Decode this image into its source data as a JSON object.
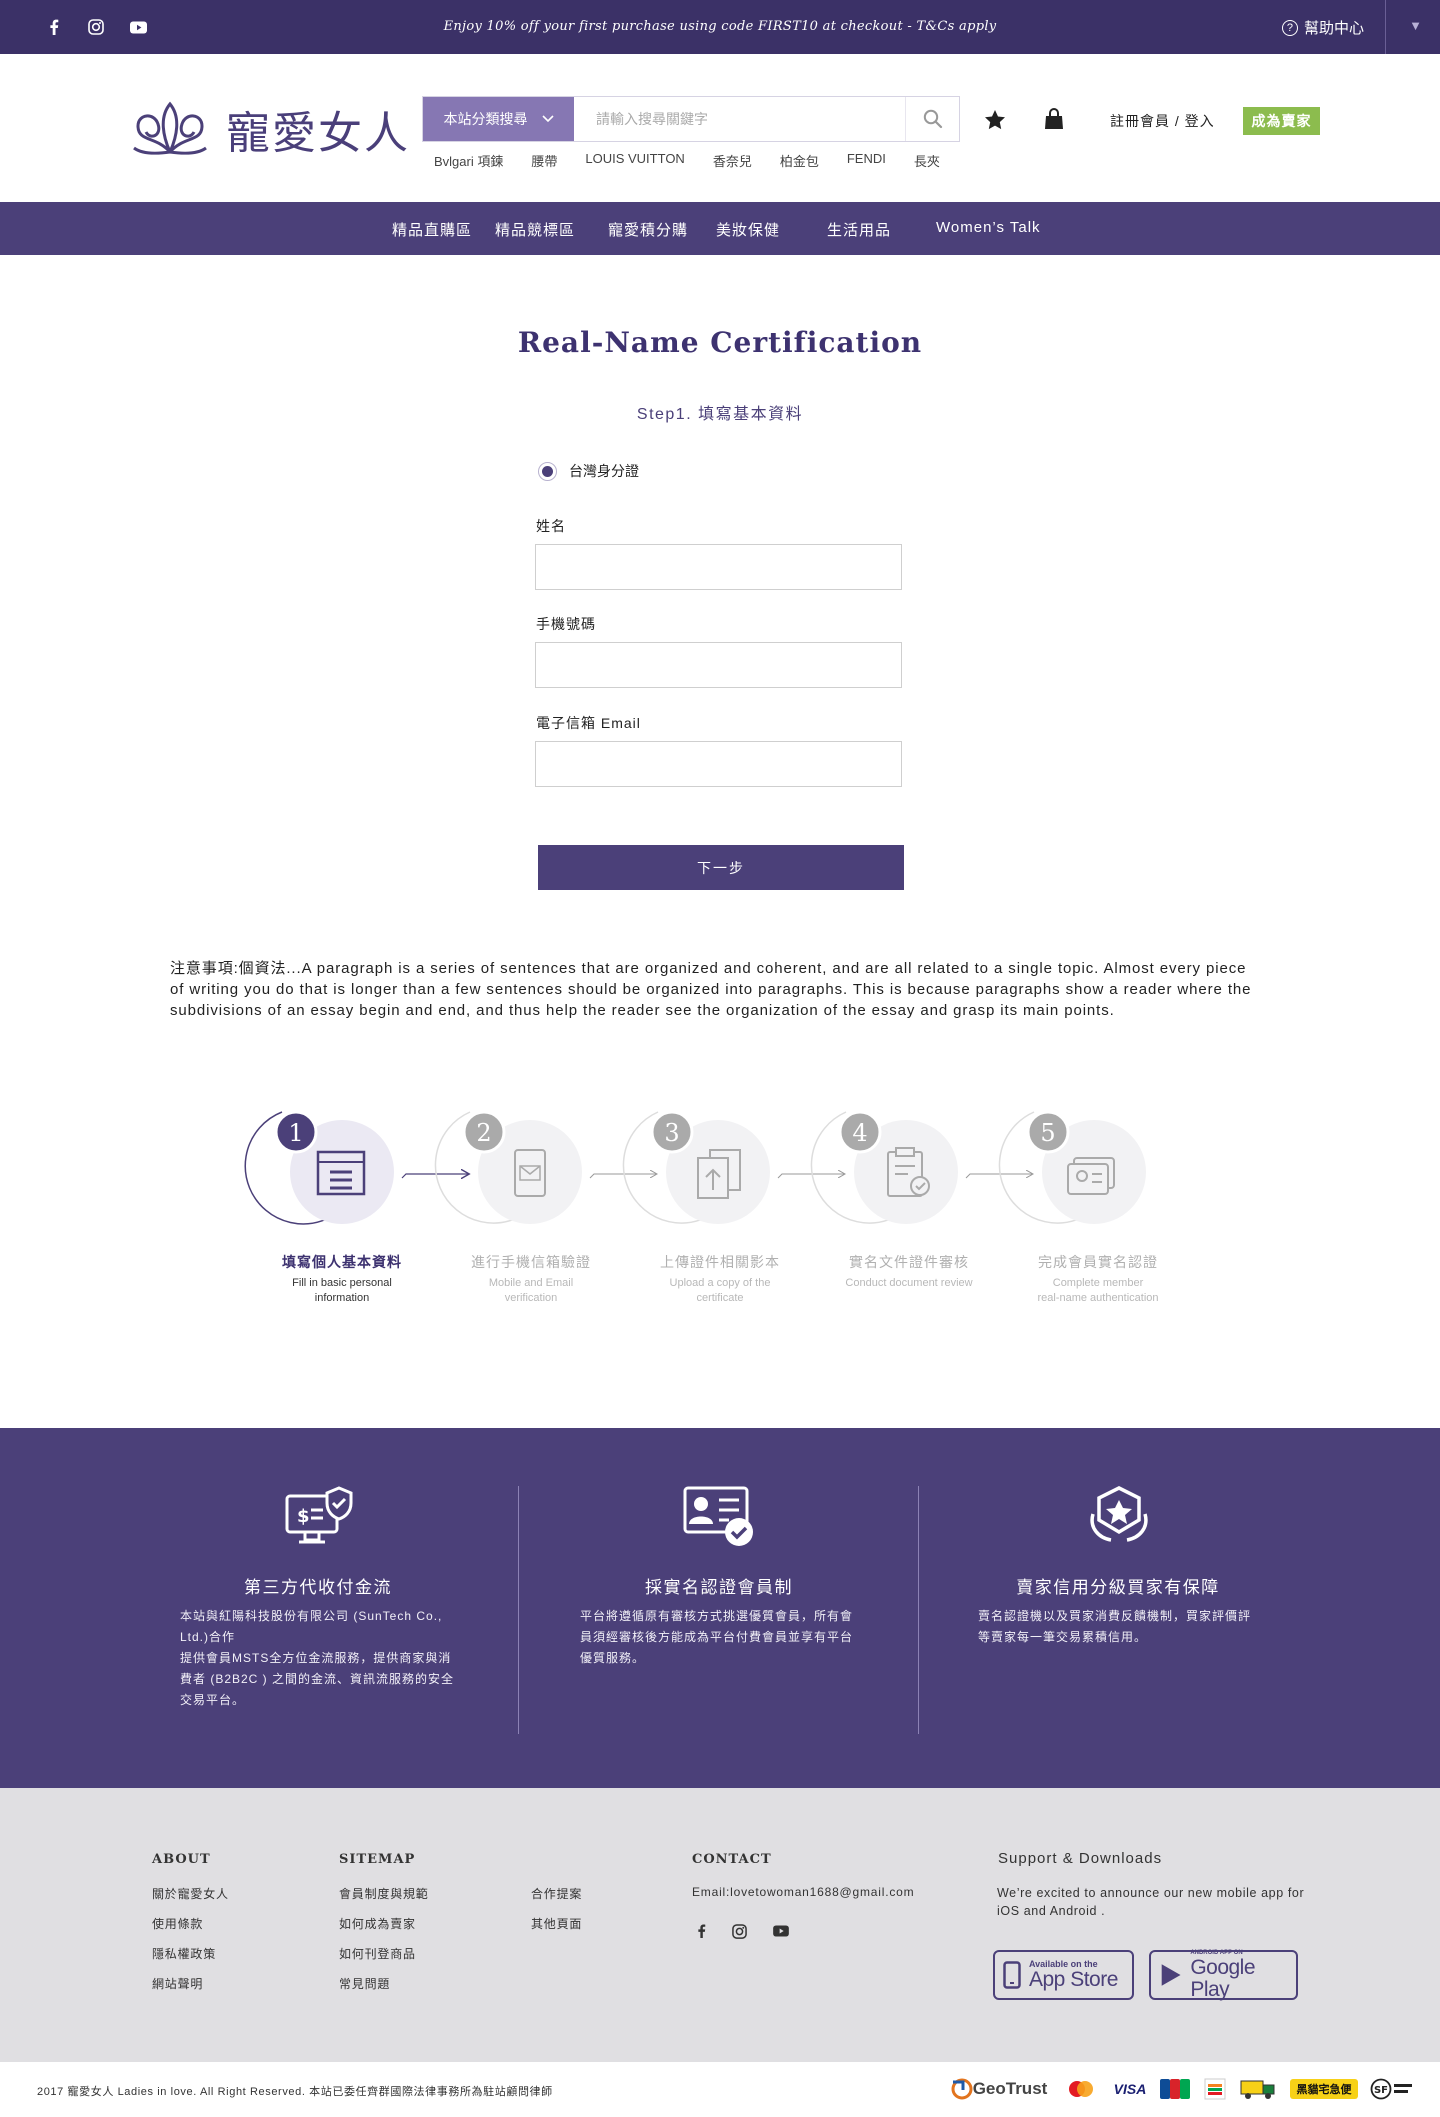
{
  "topbar": {
    "promo": "Enjoy 10% off your first purchase using code FIRST10 at checkout - T&Cs apply",
    "help": "幫助中心",
    "social_icons": [
      "facebook-icon",
      "instagram-icon",
      "youtube-icon"
    ]
  },
  "header": {
    "logo_text": "寵愛女人",
    "search": {
      "category": "本站分類搜尋",
      "placeholder": "請輸入搜尋關鍵字"
    },
    "hot_keywords": [
      "Bvlgari 項鍊",
      "腰帶",
      "LOUIS VUITTON",
      "香奈兒",
      "柏金包",
      "FENDI",
      "長夾"
    ],
    "login": "註冊會員 / 登入",
    "seller_button": "成為賣家"
  },
  "nav": {
    "items": [
      "精品直購區",
      "精品競標區",
      "寵愛積分購",
      "美妝保健",
      "生活用品",
      "Women’s Talk"
    ]
  },
  "form": {
    "title": "Real-Name Certification",
    "step": "Step1. 填寫基本資料",
    "id_type": "台灣身分證",
    "name_label": "姓名",
    "phone_label": "手機號碼",
    "email_label": "電子信箱 Email",
    "name_value": "",
    "phone_value": "",
    "email_value": "",
    "next_button": "下一步"
  },
  "note": "注意事項:個資法...A paragraph is a series of sentences that are organized and coherent, and are all related to a single topic. Almost every piece of writing you do that is longer than a few sentences should be organized into paragraphs. This is because paragraphs show a reader where the subdivisions of an essay begin and end, and thus help the reader see the organization of the essay and grasp its main points.",
  "steps": [
    {
      "num": "1",
      "title": "填寫個人基本資料",
      "sub1": "Fill in basic personal",
      "sub2": "information",
      "active": true
    },
    {
      "num": "2",
      "title": "進行手機信箱驗證",
      "sub1": "Mobile and Email",
      "sub2": "verification",
      "active": false
    },
    {
      "num": "3",
      "title": "上傳證件相關影本",
      "sub1": "Upload a copy of the",
      "sub2": "certificate",
      "active": false
    },
    {
      "num": "4",
      "title": "實名文件證件審核",
      "sub1": "Conduct document review",
      "sub2": "",
      "active": false
    },
    {
      "num": "5",
      "title": "完成會員實名認證",
      "sub1": "Complete member",
      "sub2": "real-name authentication",
      "active": false
    }
  ],
  "features": [
    {
      "title": "第三方代收付金流",
      "body": [
        "本站與紅陽科技股份有限公司 (SunTech Co.,",
        "Ltd.)合作",
        "提供會員MSTS全方位金流服務，提供商家與消",
        "費者 (B2B2C ) 之間的金流、資訊流服務的安全",
        "交易平台。"
      ]
    },
    {
      "title": "採實名認證會員制",
      "body": [
        "平台將遵循原有審核方式挑選優質會員，所有會",
        "員須經審核後方能成為平台付費會員並享有平台",
        "優質服務。"
      ]
    },
    {
      "title": "賣家信用分級買家有保障",
      "body": [
        "賣名認證機以及買家消費反饋機制，買家評價評",
        "等賣家每一筆交易累積信用。"
      ]
    }
  ],
  "footer": {
    "about_title": "ABOUT",
    "about_links": [
      "關於寵愛女人",
      "使用條款",
      "隱私權政策",
      "網站聲明"
    ],
    "sitemap_title": "SITEMAP",
    "sitemap_links": [
      "會員制度與規範",
      "如何成為賣家",
      "如何刊登商品",
      "常見問題"
    ],
    "sitemap_links2": [
      "合作提案",
      "其他頁面"
    ],
    "contact_title": "CONTACT",
    "contact_email": "Email:lovetowoman1688@gmail.com",
    "support_title": "Support & Downloads",
    "support_text": "We’re excited to announce our new mobile app  for iOS and Android .",
    "appstore_small": "Available on the",
    "appstore_big": "App Store",
    "googleplay_small": "ANDROID APP ON",
    "googleplay_big": "Google Play",
    "copyright": "2017 寵愛女人 Ladies in love. All Right Reserved.    本站已委任齊群國際法律事務所為駐站顧問律師",
    "payment_logos": [
      "GeoTrust",
      "MasterCard",
      "VISA",
      "JCB",
      "7-11",
      "黑貓宅急便",
      "SF"
    ]
  },
  "colors": {
    "primary": "#4b4079",
    "topbar": "#3b3167",
    "search_category": "#8677b3",
    "seller_green": "#8cbc4e",
    "footer_bg": "#e0dfe2"
  }
}
